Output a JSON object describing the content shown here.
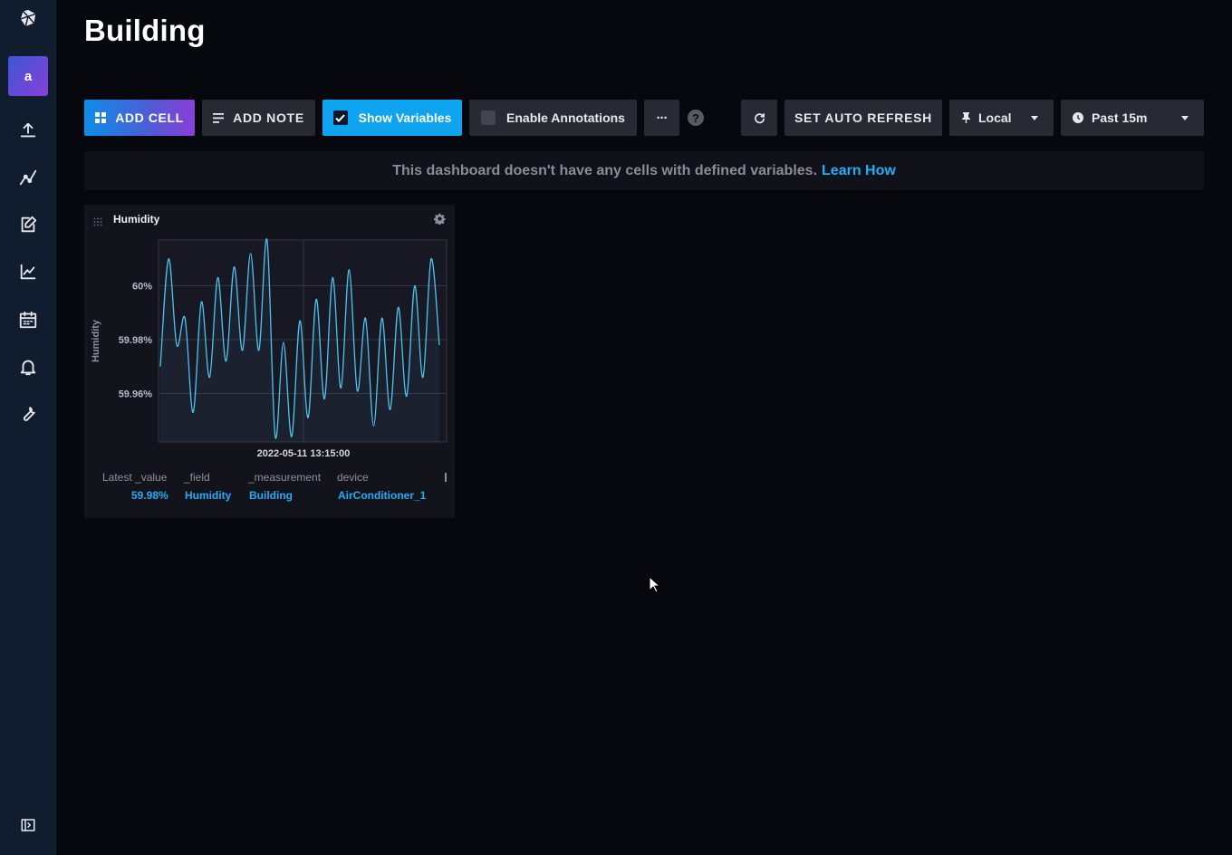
{
  "dashboard": {
    "title": "Building"
  },
  "sidebar": {
    "logo_icon": "influx-logo-icon",
    "avatar_letter": "a",
    "items": [
      {
        "name": "data-upload",
        "icon": "upload-icon"
      },
      {
        "name": "data-explorer",
        "icon": "graph-icon"
      },
      {
        "name": "notebooks",
        "icon": "notebook-edit-icon"
      },
      {
        "name": "dashboards",
        "icon": "dashboard-chart-icon"
      },
      {
        "name": "tasks",
        "icon": "calendar-icon"
      },
      {
        "name": "alerts",
        "icon": "bell-icon"
      },
      {
        "name": "settings",
        "icon": "wrench-icon"
      }
    ],
    "collapse_icon": "collapse-sidebar-icon"
  },
  "toolbar": {
    "add_cell": "ADD CELL",
    "add_note": "ADD NOTE",
    "show_variables": "Show Variables",
    "enable_annotations": "Enable Annotations",
    "more": "···",
    "help": "?",
    "auto_refresh": "SET AUTO REFRESH",
    "timezone": "Local",
    "time_range": "Past 15m"
  },
  "notice": {
    "text": "This dashboard doesn't have any cells with defined variables.",
    "link": "Learn How"
  },
  "cell": {
    "title": "Humidity",
    "table": {
      "headers": [
        "Latest _value",
        "_field",
        "_measurement",
        "device"
      ],
      "values": [
        "59.98%",
        "Humidity",
        "Building",
        "AirConditioner_1"
      ]
    }
  },
  "chart_data": {
    "type": "line",
    "title": "",
    "xlabel": "2022-05-11 13:15:00",
    "ylabel": "Humidity",
    "y_ticks": [
      "60%",
      "59.98%",
      "59.96%"
    ],
    "y_tick_values": [
      60.0,
      59.98,
      59.96
    ],
    "ylim": [
      59.942,
      60.017
    ],
    "x_tick": "2022-05-11 13:15:00",
    "grid": true,
    "color": "#4ec3ee",
    "series": [
      {
        "values": [
          59.97,
          60.01,
          59.978,
          59.988,
          59.953,
          59.994,
          59.966,
          60.003,
          59.972,
          60.007,
          59.976,
          60.012,
          59.976,
          60.017,
          59.944,
          59.979,
          59.944,
          59.987,
          59.951,
          59.995,
          59.958,
          60.003,
          59.962,
          60.006,
          59.961,
          59.988,
          59.948,
          59.988,
          59.954,
          59.992,
          59.959,
          60.0,
          59.966,
          60.01,
          59.978
        ]
      }
    ]
  },
  "colors": {
    "accent": "#22adf6",
    "primary_gradient": [
      "#0b8ee8",
      "#8a3ed8"
    ],
    "sidebar_bg": "#0f1d2e",
    "page_bg": "#07070e"
  }
}
